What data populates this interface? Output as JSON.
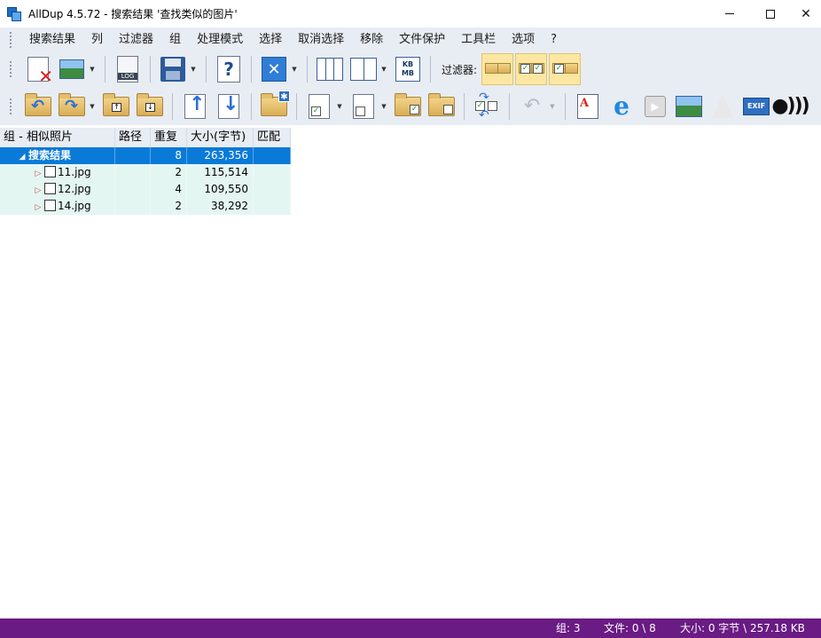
{
  "window": {
    "title": "AllDup 4.5.72 - 搜索结果 '查找类似的图片'",
    "minimize_glyph": "",
    "close_glyph": "✕"
  },
  "menu": [
    "搜索结果",
    "列",
    "过滤器",
    "组",
    "处理模式",
    "选择",
    "取消选择",
    "移除",
    "文件保护",
    "工具栏",
    "选项",
    "?"
  ],
  "toolbar": {
    "filter_label": "过滤器:",
    "log_label": "LOG",
    "kbmb_label": "KB\nMB",
    "exif_label": "EXIF",
    "help_glyph": "?",
    "close_x_glyph": "✕"
  },
  "table": {
    "headers": [
      "组 - 相似照片",
      "路径",
      "重复",
      "大小(字节)",
      "匹配"
    ],
    "group": {
      "name": "搜索结果",
      "duplicates": "8",
      "size": "263,356"
    },
    "rows": [
      {
        "name": "11.jpg",
        "duplicates": "2",
        "size": "115,514"
      },
      {
        "name": "12.jpg",
        "duplicates": "4",
        "size": "109,550"
      },
      {
        "name": "14.jpg",
        "duplicates": "2",
        "size": "38,292"
      }
    ]
  },
  "status": {
    "groups": "组: 3",
    "files": "文件: 0 \\ 8",
    "size": "大小: 0 字节 \\ 257.18 KB"
  },
  "colors": {
    "status_bar": "#6a1b84",
    "selection": "#0a7ad8",
    "row_background": "#e4f6f2",
    "toolbar_background": "#e8ecf3"
  }
}
